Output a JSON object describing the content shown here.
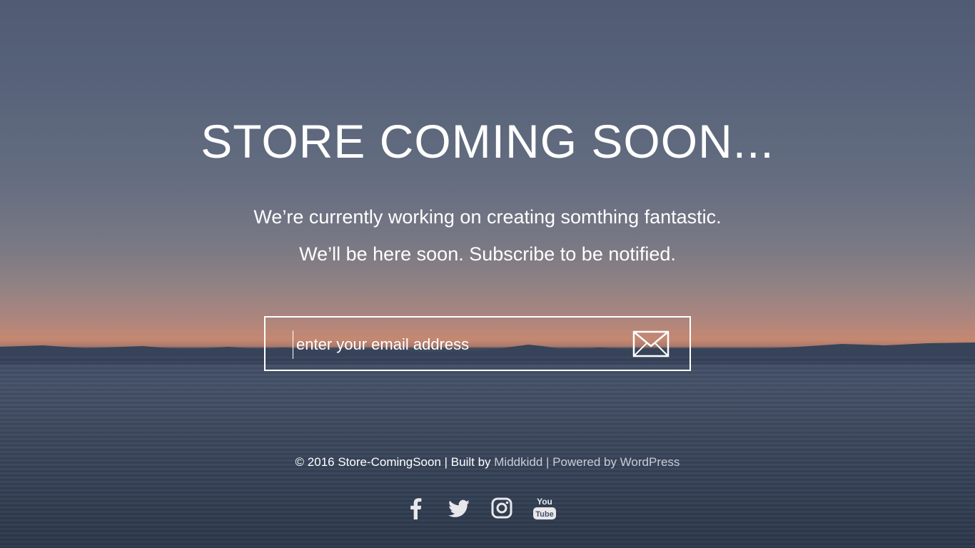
{
  "headline": "STORE COMING SOON...",
  "subtitle_line1": "We’re currently working on creating somthing fantastic.",
  "subtitle_line2": "We’ll be here soon. Subscribe to be notified.",
  "email_form": {
    "placeholder": "enter your email address",
    "value": "",
    "submit_icon": "envelope-icon"
  },
  "footer": {
    "copyright": "© 2016 Store-ComingSoon | Built by ",
    "builder_link": "Middkidd",
    "separator": " | ",
    "powered_by": "Powered by WordPress"
  },
  "social": [
    {
      "name": "facebook",
      "icon": "facebook-icon"
    },
    {
      "name": "twitter",
      "icon": "twitter-icon"
    },
    {
      "name": "instagram",
      "icon": "instagram-icon"
    },
    {
      "name": "youtube",
      "icon": "youtube-icon",
      "label_top": "You",
      "label_bottom": "Tube"
    }
  ],
  "colors": {
    "text": "#ffffff",
    "muted_link": "#c9ccd4",
    "sky_top": "#556079",
    "horizon": "#d49176",
    "water": "#46526a"
  }
}
